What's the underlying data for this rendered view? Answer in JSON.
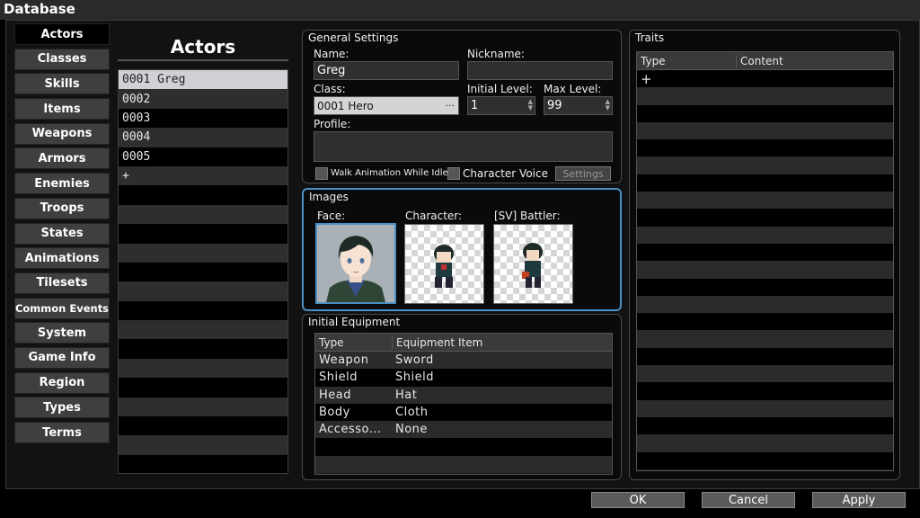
{
  "window": {
    "title": "Database"
  },
  "categories": [
    "Actors",
    "Classes",
    "Skills",
    "Items",
    "Weapons",
    "Armors",
    "Enemies",
    "Troops",
    "States",
    "Animations",
    "Tilesets",
    "Common Events",
    "System",
    "Game Info",
    "Region",
    "Types",
    "Terms"
  ],
  "actors": {
    "title": "Actors",
    "items": [
      "0001 Greg",
      "0002",
      "0003",
      "0004",
      "0005",
      "+"
    ]
  },
  "general": {
    "title": "General Settings",
    "name_label": "Name:",
    "name_value": "Greg",
    "nickname_label": "Nickname:",
    "nickname_value": "",
    "class_label": "Class:",
    "class_value": "0001 Hero",
    "class_btn": "...",
    "initial_level_label": "Initial Level:",
    "initial_level_value": "1",
    "max_level_label": "Max Level:",
    "max_level_value": "99",
    "profile_label": "Profile:",
    "profile_value": "",
    "walk_anim_label": "Walk Animation While Idle",
    "char_voice_label": "Character Voice",
    "settings_btn": "Settings"
  },
  "images": {
    "title": "Images",
    "face_label": "Face:",
    "character_label": "Character:",
    "battler_label": "[SV] Battler:"
  },
  "equipment": {
    "title": "Initial Equipment",
    "headers": [
      "Type",
      "Equipment Item"
    ],
    "rows": [
      [
        "Weapon",
        "Sword"
      ],
      [
        "Shield",
        "Shield"
      ],
      [
        "Head",
        "Hat"
      ],
      [
        "Body",
        "Cloth"
      ],
      [
        "Accesso...",
        "None"
      ]
    ]
  },
  "traits": {
    "title": "Traits",
    "headers": [
      "Type",
      "Content"
    ],
    "add": "+"
  },
  "footer": {
    "ok": "OK",
    "cancel": "Cancel",
    "apply": "Apply"
  }
}
